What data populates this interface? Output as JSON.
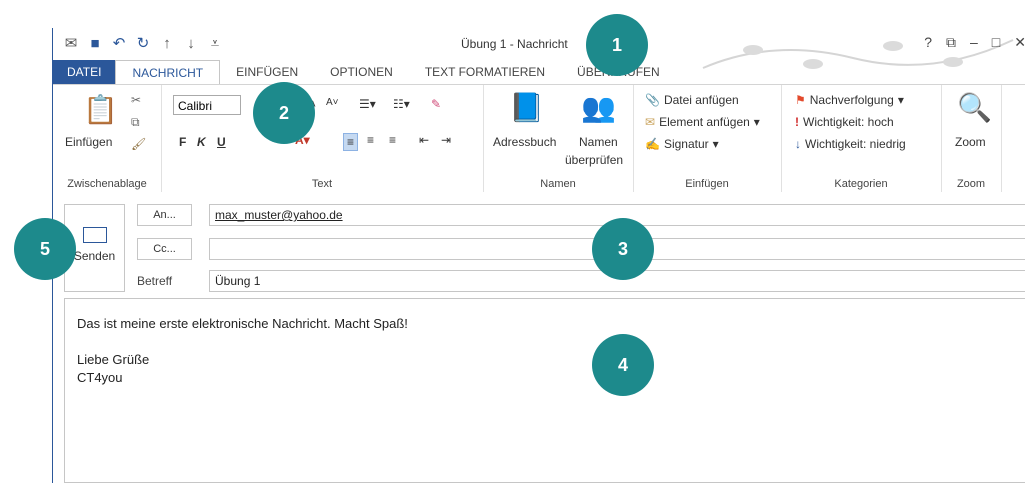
{
  "window": {
    "title": "Übung 1 - Nachricht",
    "controls": [
      "?",
      "⧉",
      "–",
      "□",
      "✕"
    ]
  },
  "quick_access": [
    "mail-icon",
    "save-icon",
    "undo-icon",
    "redo-icon",
    "arrow-up-icon",
    "arrow-down-icon",
    "customize-icon"
  ],
  "tabs": [
    {
      "label": "DATEI"
    },
    {
      "label": "NACHRICHT"
    },
    {
      "label": "EINFÜGEN"
    },
    {
      "label": "OPTIONEN"
    },
    {
      "label": "TEXT FORMATIEREN"
    },
    {
      "label": "ÜBERPRÜFEN"
    }
  ],
  "ribbon": {
    "clipboard": {
      "paste": "Einfügen",
      "label": "Zwischenablage"
    },
    "text": {
      "font": "Calibri",
      "bold": "F",
      "italic": "K",
      "underline": "U",
      "label": "Text"
    },
    "names": {
      "addressbook": "Adressbuch",
      "check_names_1": "Namen",
      "check_names_2": "überprüfen",
      "label": "Namen"
    },
    "insert": {
      "attach_file": "Datei anfügen",
      "attach_item": "Element anfügen",
      "signature": "Signatur",
      "label": "Einfügen"
    },
    "categories": {
      "followup": "Nachverfolgung",
      "high": "Wichtigkeit: hoch",
      "low": "Wichtigkeit: niedrig",
      "label": "Kategorien"
    },
    "zoom": {
      "button": "Zoom",
      "label": "Zoom"
    }
  },
  "compose": {
    "send": "Senden",
    "to_button": "An...",
    "cc_button": "Cc...",
    "to_value": "max_muster@yahoo.de",
    "cc_value": "",
    "subject_label": "Betreff",
    "subject_value": "Übung 1",
    "body_lines": [
      "Das ist meine erste elektronische Nachricht. Macht Spaß!",
      "",
      "Liebe Grüße",
      "CT4you"
    ]
  },
  "badges": [
    "1",
    "2",
    "3",
    "4",
    "5"
  ],
  "colors": {
    "accent": "#2b579a",
    "badge": "#1d8a8c"
  }
}
